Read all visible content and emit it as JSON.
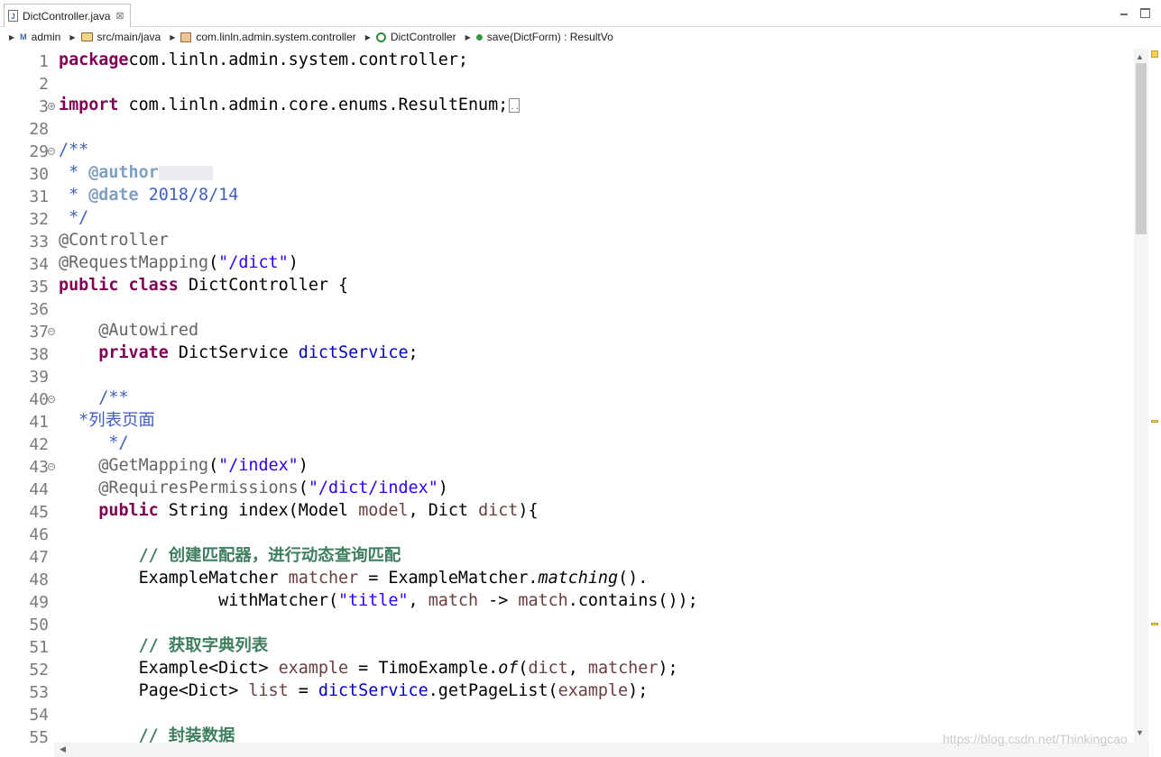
{
  "tab": {
    "title": "DictController.java",
    "close_symbol": "⊠"
  },
  "breadcrumb": [
    {
      "label": "admin",
      "icon": "project-icon"
    },
    {
      "label": "src/main/java",
      "icon": "source-folder-icon"
    },
    {
      "label": "com.linln.admin.system.controller",
      "icon": "package-icon"
    },
    {
      "label": "DictController",
      "icon": "class-icon"
    },
    {
      "label": "save(DictForm) : ResultVo",
      "icon": "method-icon"
    }
  ],
  "lines": [
    {
      "n": "1",
      "tokens": [
        [
          "kw",
          "package"
        ],
        [
          "",
          "com.linln.admin.system.controller;"
        ]
      ]
    },
    {
      "n": "2",
      "tokens": []
    },
    {
      "n": "3",
      "fold": "plus",
      "tokens": [
        [
          "kw",
          "import"
        ],
        [
          "",
          " com.linln.admin.core.enums.ResultEnum;"
        ],
        [
          "collapsed",
          ".."
        ]
      ]
    },
    {
      "n": "28",
      "tokens": []
    },
    {
      "n": "29",
      "fold": "minus",
      "tokens": [
        [
          "cmt",
          "/**"
        ]
      ]
    },
    {
      "n": "30",
      "tokens": [
        [
          "cmt",
          " * "
        ],
        [
          "tag",
          "@author"
        ],
        [
          "blur",
          ""
        ]
      ]
    },
    {
      "n": "31",
      "tokens": [
        [
          "cmt",
          " * "
        ],
        [
          "tag",
          "@date"
        ],
        [
          "cmt",
          " 2018/8/14"
        ]
      ]
    },
    {
      "n": "32",
      "tokens": [
        [
          "cmt",
          " */"
        ]
      ]
    },
    {
      "n": "33",
      "tokens": [
        [
          "ann",
          "@Controller"
        ]
      ]
    },
    {
      "n": "34",
      "tokens": [
        [
          "ann",
          "@RequestMapping"
        ],
        [
          "",
          "("
        ],
        [
          "str",
          "\"/dict\""
        ],
        [
          "",
          ")"
        ]
      ]
    },
    {
      "n": "35",
      "tokens": [
        [
          "kw",
          "public"
        ],
        [
          "",
          " "
        ],
        [
          "kw",
          "class"
        ],
        [
          "",
          " DictController {"
        ]
      ]
    },
    {
      "n": "36",
      "tokens": []
    },
    {
      "n": "37",
      "fold": "minus",
      "tokens": [
        [
          "",
          "    "
        ],
        [
          "ann",
          "@Autowired"
        ]
      ]
    },
    {
      "n": "38",
      "tokens": [
        [
          "",
          "    "
        ],
        [
          "kw",
          "private"
        ],
        [
          "",
          " DictService "
        ],
        [
          "fld",
          "dictService"
        ],
        [
          "",
          ";"
        ]
      ]
    },
    {
      "n": "39",
      "tokens": []
    },
    {
      "n": "40",
      "fold": "minus",
      "tokens": [
        [
          "",
          "    "
        ],
        [
          "cmt",
          "/**"
        ]
      ]
    },
    {
      "n": "41",
      "tokens": [
        [
          "cmt",
          "  *列表页面"
        ]
      ]
    },
    {
      "n": "42",
      "tokens": [
        [
          "cmt",
          "     */"
        ]
      ]
    },
    {
      "n": "43",
      "fold": "minus",
      "tokens": [
        [
          "",
          "    "
        ],
        [
          "ann",
          "@GetMapping"
        ],
        [
          "",
          "("
        ],
        [
          "str",
          "\"/index\""
        ],
        [
          "",
          ")"
        ]
      ]
    },
    {
      "n": "44",
      "tokens": [
        [
          "",
          "    "
        ],
        [
          "ann",
          "@RequiresPermissions"
        ],
        [
          "",
          "("
        ],
        [
          "str",
          "\"/dict/index\""
        ],
        [
          "",
          ")"
        ]
      ]
    },
    {
      "n": "45",
      "tokens": [
        [
          "",
          "    "
        ],
        [
          "kw",
          "public"
        ],
        [
          "",
          " String index(Model "
        ],
        [
          "var",
          "model"
        ],
        [
          "",
          ", Dict "
        ],
        [
          "var",
          "dict"
        ],
        [
          "",
          "){"
        ]
      ]
    },
    {
      "n": "46",
      "tokens": []
    },
    {
      "n": "47",
      "tokens": [
        [
          "",
          "        "
        ],
        [
          "lc",
          "// 创建匹配器，进行动态查询匹配"
        ]
      ]
    },
    {
      "n": "48",
      "tokens": [
        [
          "",
          "        ExampleMatcher "
        ],
        [
          "var",
          "matcher"
        ],
        [
          "",
          " = ExampleMatcher."
        ],
        [
          "ital",
          "matching"
        ],
        [
          "",
          "()."
        ]
      ]
    },
    {
      "n": "49",
      "tokens": [
        [
          "",
          "                withMatcher("
        ],
        [
          "str",
          "\"title\""
        ],
        [
          "",
          ", "
        ],
        [
          "var",
          "match"
        ],
        [
          "",
          " -> "
        ],
        [
          "var",
          "match"
        ],
        [
          "",
          ".contains());"
        ]
      ]
    },
    {
      "n": "50",
      "tokens": []
    },
    {
      "n": "51",
      "tokens": [
        [
          "",
          "        "
        ],
        [
          "lc",
          "// 获取字典列表"
        ]
      ]
    },
    {
      "n": "52",
      "tokens": [
        [
          "",
          "        Example<Dict> "
        ],
        [
          "var",
          "example"
        ],
        [
          "",
          " = TimoExample."
        ],
        [
          "ital",
          "of"
        ],
        [
          "",
          "("
        ],
        [
          "var",
          "dict"
        ],
        [
          "",
          ", "
        ],
        [
          "var",
          "matcher"
        ],
        [
          "",
          ");"
        ]
      ]
    },
    {
      "n": "53",
      "tokens": [
        [
          "",
          "        Page<Dict> "
        ],
        [
          "var",
          "list"
        ],
        [
          "",
          " = "
        ],
        [
          "fld",
          "dictService"
        ],
        [
          "",
          ".getPageList("
        ],
        [
          "var",
          "example"
        ],
        [
          "",
          ");"
        ]
      ]
    },
    {
      "n": "54",
      "tokens": []
    },
    {
      "n": "55",
      "tokens": [
        [
          "",
          "        "
        ],
        [
          "lc",
          "// 封装数据"
        ]
      ]
    }
  ],
  "watermark": "https://blog.csdn.net/Thinkingcao"
}
